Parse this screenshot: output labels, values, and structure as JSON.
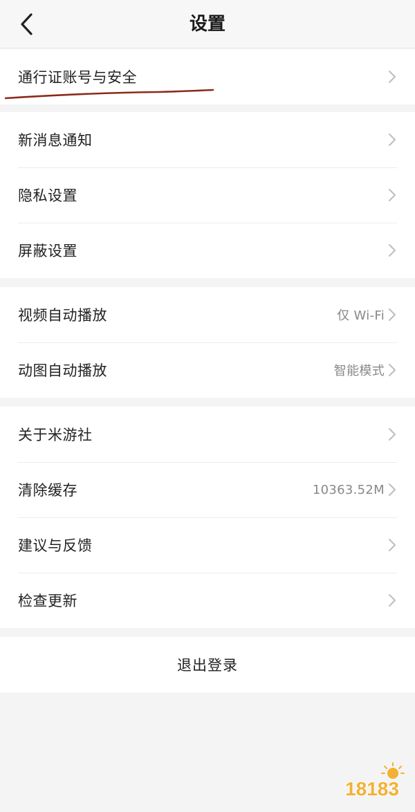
{
  "header": {
    "title": "设置",
    "back_icon": "chevron-left-icon"
  },
  "groups": [
    {
      "items": [
        {
          "label": "通行证账号与安全",
          "value": ""
        }
      ]
    },
    {
      "items": [
        {
          "label": "新消息通知",
          "value": ""
        },
        {
          "label": "隐私设置",
          "value": ""
        },
        {
          "label": "屏蔽设置",
          "value": ""
        }
      ]
    },
    {
      "items": [
        {
          "label": "视频自动播放",
          "value": "仅 Wi-Fi"
        },
        {
          "label": "动图自动播放",
          "value": "智能模式"
        }
      ]
    },
    {
      "items": [
        {
          "label": "关于米游社",
          "value": ""
        },
        {
          "label": "清除缓存",
          "value": "10363.52M"
        },
        {
          "label": "建议与反馈",
          "value": ""
        },
        {
          "label": "检查更新",
          "value": ""
        }
      ]
    }
  ],
  "logout": {
    "label": "退出登录"
  },
  "watermark": {
    "text": "18183"
  },
  "colors": {
    "background": "#f4f4f4",
    "row_bg": "#ffffff",
    "annotation_underline": "#8b2a1a",
    "value_text": "#888888",
    "chevron": "#bdbdbd"
  }
}
